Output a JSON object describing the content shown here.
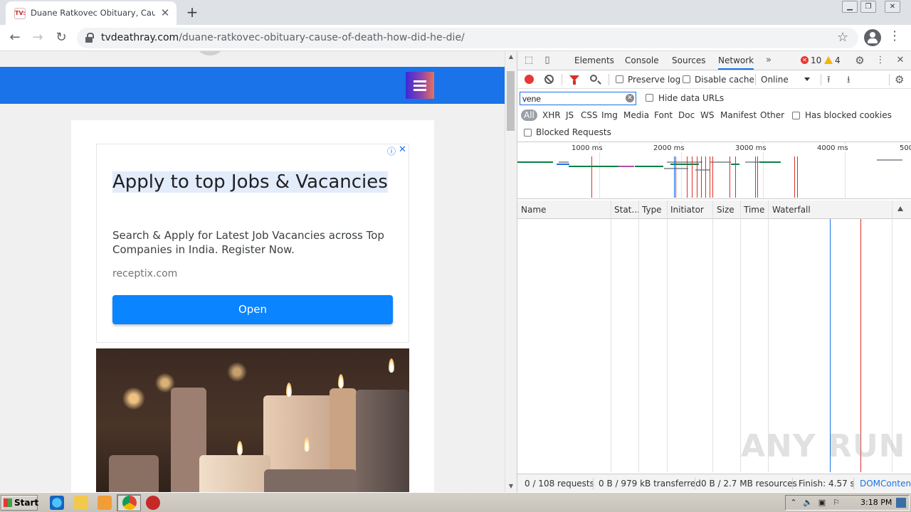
{
  "browser": {
    "tab": {
      "title": "Duane Ratkovec Obituary, Cause of",
      "favicon_text": "TV:"
    },
    "url": {
      "domain": "tvdeathray.com",
      "path": "/duane-ratkovec-obituary-cause-of-death-how-did-he-die/"
    }
  },
  "ad": {
    "headline": "Apply to top Jobs & Vacancies",
    "body": "Search & Apply for Latest Job Vacancies across Top Companies in India. Register Now.",
    "domain": "receptix.com",
    "cta": "Open"
  },
  "devtools": {
    "tabs": [
      "Elements",
      "Console",
      "Sources",
      "Network"
    ],
    "active_tab": "Network",
    "error_count": "10",
    "warning_count": "4",
    "toolbar": {
      "preserve_log": "Preserve log",
      "disable_cache": "Disable cache",
      "throttle": "Online"
    },
    "filter": {
      "value": "vene",
      "hide_data_urls": "Hide data URLs"
    },
    "resource_types": [
      "All",
      "XHR",
      "JS",
      "CSS",
      "Img",
      "Media",
      "Font",
      "Doc",
      "WS",
      "Manifest",
      "Other"
    ],
    "has_blocked_cookies": "Has blocked cookies",
    "blocked_requests": "Blocked Requests",
    "timeline_ticks": [
      "1000 ms",
      "2000 ms",
      "3000 ms",
      "4000 ms",
      "500"
    ],
    "columns": [
      "Name",
      "Stat...",
      "Type",
      "Initiator",
      "Size",
      "Time",
      "Waterfall"
    ],
    "status": {
      "requests": "0 / 108 requests",
      "transferred": "0 B / 979 kB transferred",
      "resources": "0 B / 2.7 MB resources",
      "finish": "Finish: 4.57 s",
      "domcontent": "DOMContent"
    }
  },
  "watermark": "ANY RUN",
  "taskbar": {
    "start": "Start",
    "clock": "3:18 PM"
  },
  "colors": {
    "site_nav": "#1a73e8",
    "ad_button": "#0a84ff",
    "record": "#e53935",
    "dom_content_line": "#1a73e8",
    "load_line": "#d93025"
  }
}
